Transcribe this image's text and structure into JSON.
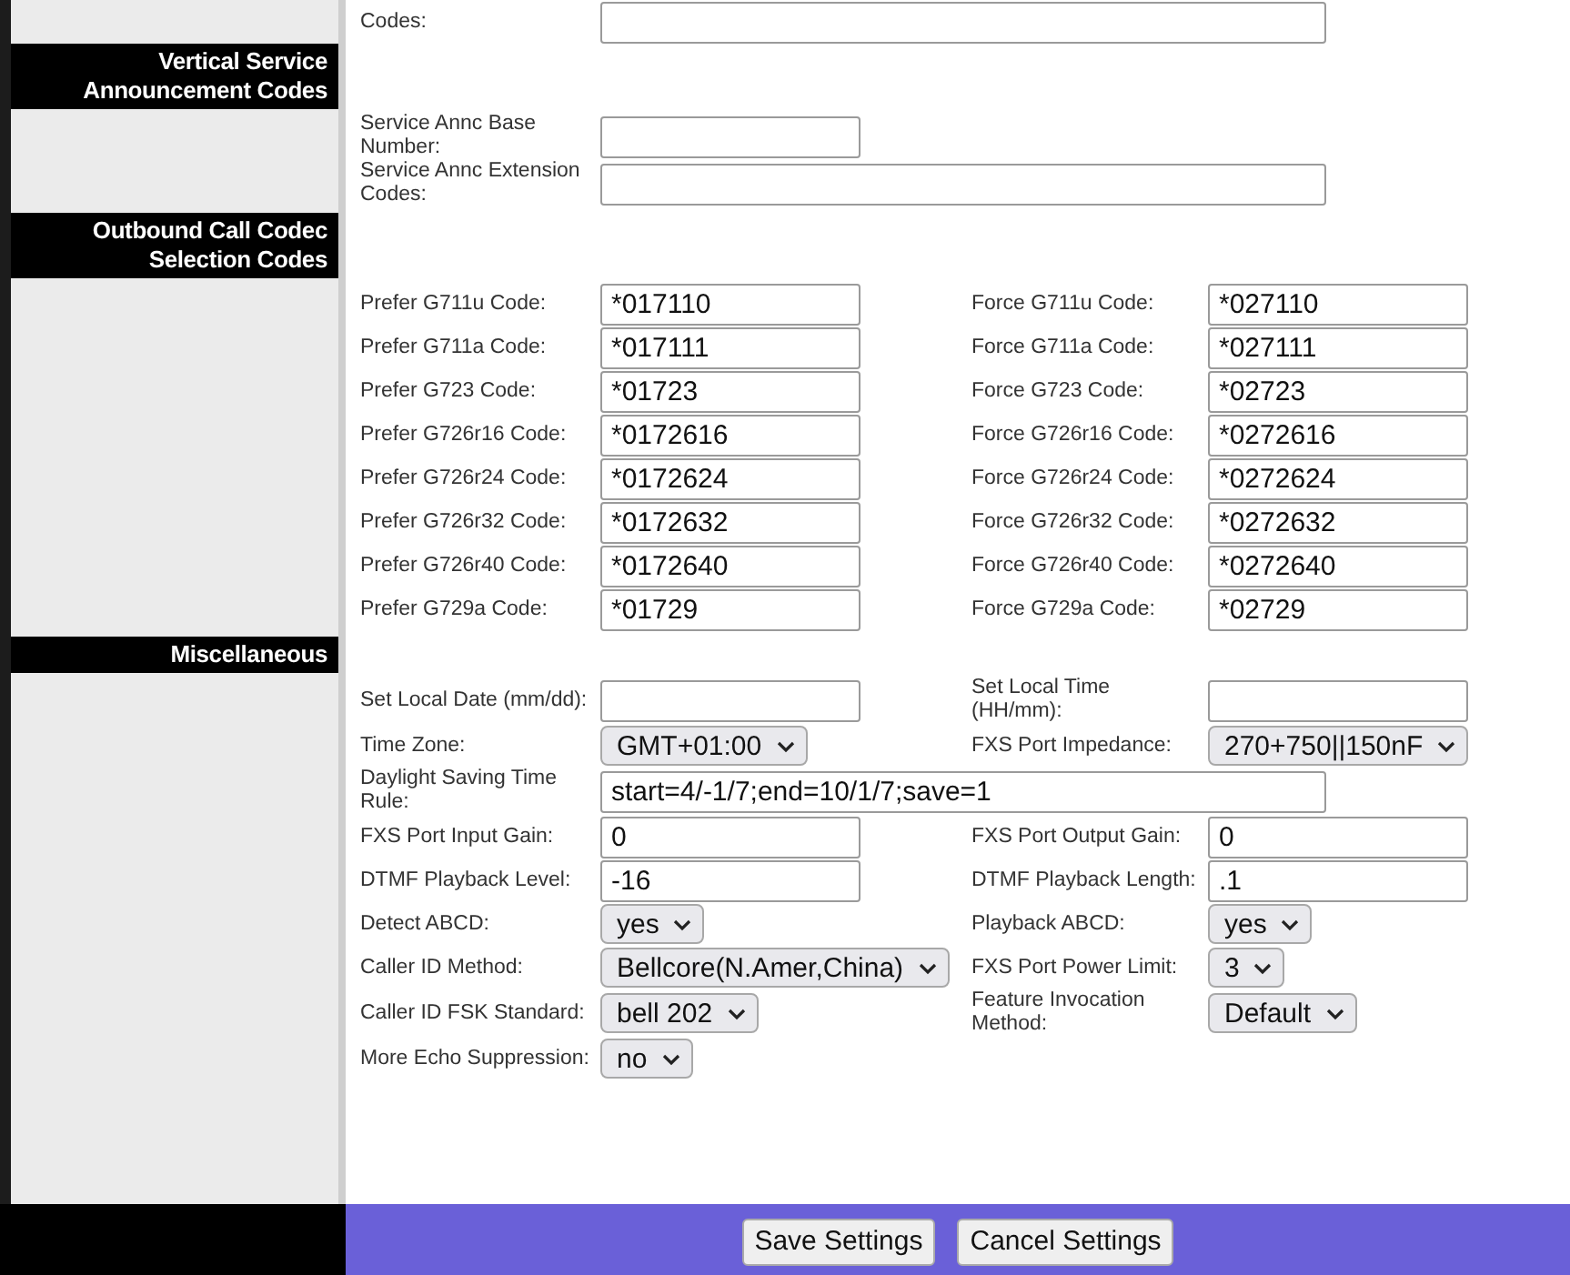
{
  "top_row": {
    "label": "Codes:",
    "kind": "wide"
  },
  "sections": [
    {
      "title": "Vertical Service Announcement Codes",
      "rows": [
        {
          "cells": [
            {
              "kind": "text",
              "label": "Service Annc Base Number:"
            }
          ]
        },
        {
          "cells": [
            {
              "kind": "wide",
              "label": "Service Annc Extension Codes:"
            }
          ]
        }
      ]
    },
    {
      "title": "Outbound Call Codec Selection Codes",
      "rows": [
        {
          "cells": [
            {
              "kind": "text",
              "label": "Prefer G711u Code:",
              "value": "*017110"
            },
            {
              "kind": "text",
              "label": "Force G711u Code:",
              "value": "*027110"
            }
          ]
        },
        {
          "cells": [
            {
              "kind": "text",
              "label": "Prefer G711a Code:",
              "value": "*017111"
            },
            {
              "kind": "text",
              "label": "Force G711a Code:",
              "value": "*027111"
            }
          ]
        },
        {
          "cells": [
            {
              "kind": "text",
              "label": "Prefer G723 Code:",
              "value": "*01723"
            },
            {
              "kind": "text",
              "label": "Force G723 Code:",
              "value": "*02723"
            }
          ]
        },
        {
          "cells": [
            {
              "kind": "text",
              "label": "Prefer G726r16 Code:",
              "value": "*0172616"
            },
            {
              "kind": "text",
              "label": "Force G726r16 Code:",
              "value": "*0272616"
            }
          ]
        },
        {
          "cells": [
            {
              "kind": "text",
              "label": "Prefer G726r24 Code:",
              "value": "*0172624"
            },
            {
              "kind": "text",
              "label": "Force G726r24 Code:",
              "value": "*0272624"
            }
          ]
        },
        {
          "cells": [
            {
              "kind": "text",
              "label": "Prefer G726r32 Code:",
              "value": "*0172632"
            },
            {
              "kind": "text",
              "label": "Force G726r32 Code:",
              "value": "*0272632"
            }
          ]
        },
        {
          "cells": [
            {
              "kind": "text",
              "label": "Prefer G726r40 Code:",
              "value": "*0172640"
            },
            {
              "kind": "text",
              "label": "Force G726r40 Code:",
              "value": "*0272640"
            }
          ]
        },
        {
          "cells": [
            {
              "kind": "text",
              "label": "Prefer G729a Code:",
              "value": "*01729"
            },
            {
              "kind": "text",
              "label": "Force G729a Code:",
              "value": "*02729"
            }
          ]
        }
      ]
    },
    {
      "title": "Miscellaneous",
      "rows": [
        {
          "cells": [
            {
              "kind": "text",
              "label": "Set Local Date (mm/dd):"
            },
            {
              "kind": "text",
              "label": "Set Local Time (HH/mm):"
            }
          ]
        },
        {
          "cells": [
            {
              "kind": "select",
              "label": "Time Zone:",
              "value": "GMT+01:00"
            },
            {
              "kind": "select",
              "label": "FXS Port Impedance:",
              "value": "270+750||150nF"
            }
          ]
        },
        {
          "cells": [
            {
              "kind": "wide",
              "label": "Daylight Saving Time Rule:",
              "value": "start=4/-1/7;end=10/1/7;save=1"
            }
          ]
        },
        {
          "cells": [
            {
              "kind": "text",
              "label": "FXS Port Input Gain:",
              "value": "0"
            },
            {
              "kind": "text",
              "label": "FXS Port Output Gain:",
              "value": "0"
            }
          ]
        },
        {
          "cells": [
            {
              "kind": "text",
              "label": "DTMF Playback Level:",
              "value": "-16"
            },
            {
              "kind": "text",
              "label": "DTMF Playback Length:",
              "value": ".1"
            }
          ]
        },
        {
          "cells": [
            {
              "kind": "select",
              "label": "Detect ABCD:",
              "value": "yes"
            },
            {
              "kind": "select",
              "label": "Playback ABCD:",
              "value": "yes"
            }
          ]
        },
        {
          "cells": [
            {
              "kind": "select",
              "label": "Caller ID Method:",
              "value": "Bellcore(N.Amer,China)"
            },
            {
              "kind": "select",
              "label": "FXS Port Power Limit:",
              "value": "3"
            }
          ]
        },
        {
          "cells": [
            {
              "kind": "select",
              "label": "Caller ID FSK Standard:",
              "value": "bell 202"
            },
            {
              "kind": "select",
              "label": "Feature Invocation Method:",
              "value": "Default"
            }
          ]
        },
        {
          "cells": [
            {
              "kind": "select",
              "label": "More Echo Suppression:",
              "value": "no"
            }
          ]
        }
      ]
    }
  ],
  "buttons": [
    {
      "label": "Save Settings"
    },
    {
      "label": "Cancel Settings"
    }
  ]
}
